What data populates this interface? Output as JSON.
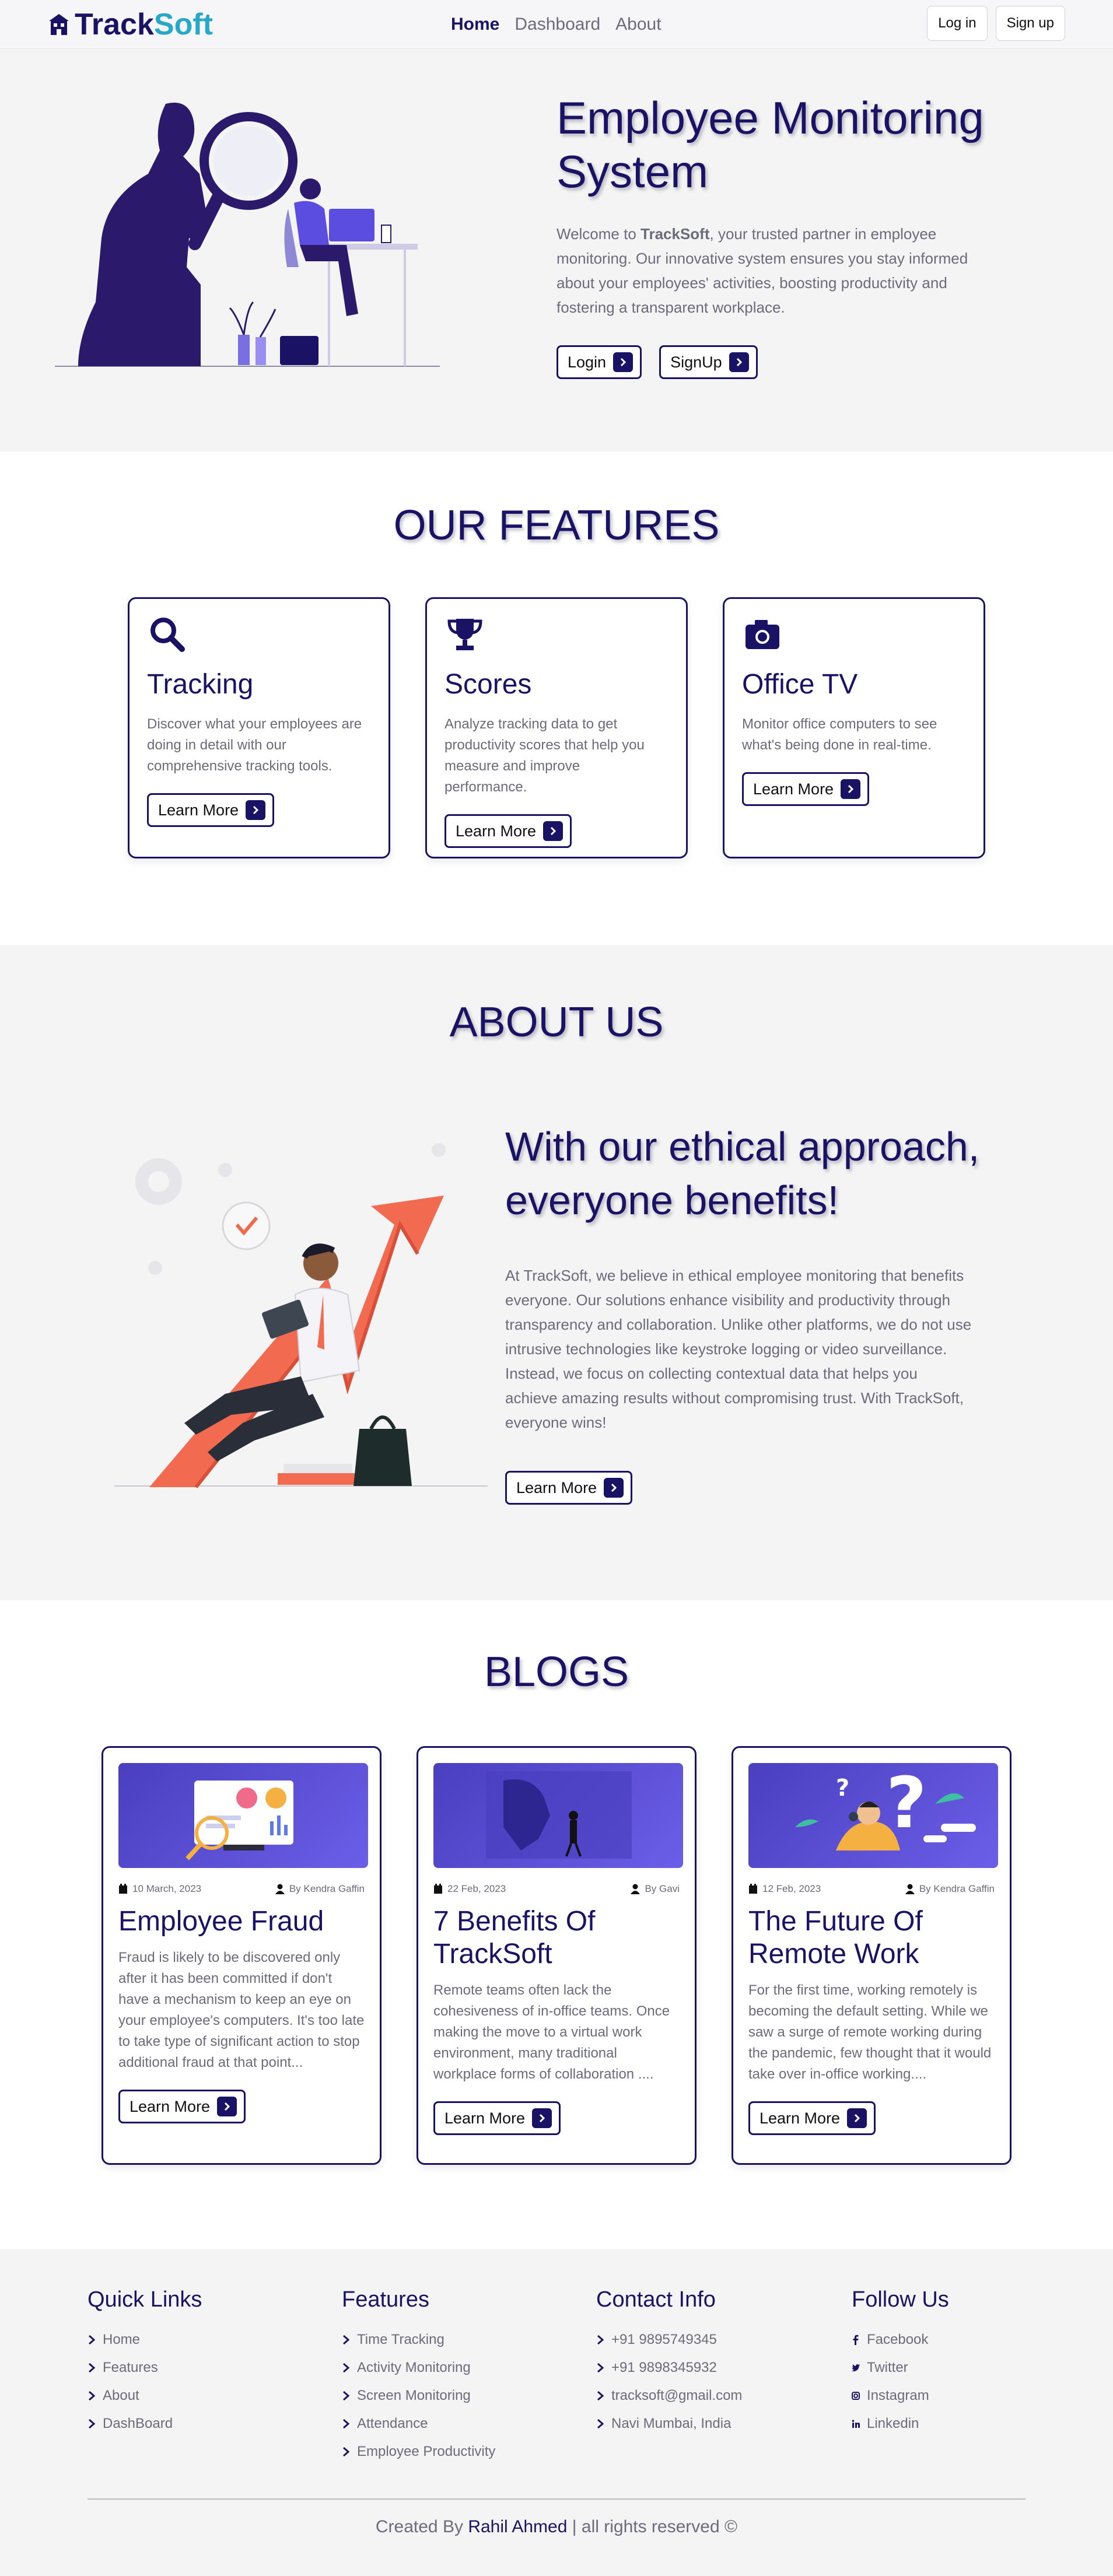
{
  "nav": {
    "brand_track": "Track",
    "brand_soft": "Soft",
    "links": [
      "Home",
      "Dashboard",
      "About"
    ],
    "login": "Log in",
    "signup": "Sign up"
  },
  "hero": {
    "title": "Employee Monitoring System",
    "desc_prefix": "Welcome to ",
    "desc_brand": "TrackSoft",
    "desc_rest": ", your trusted partner in employee monitoring. Our innovative system ensures you stay informed about your employees' activities, boosting productivity and fostering a transparent workplace.",
    "login_btn": "Login",
    "signup_btn": "SignUp"
  },
  "features": {
    "title": "OUR FEATURES",
    "cards": [
      {
        "icon": "search-icon",
        "title": "Tracking",
        "desc": "Discover what your employees are doing in detail with our comprehensive tracking tools.",
        "button": "Learn More"
      },
      {
        "icon": "trophy-icon",
        "title": "Scores",
        "desc": "Analyze tracking data to get productivity scores that help you measure and improve performance.",
        "button": "Learn More"
      },
      {
        "icon": "camera-icon",
        "title": "Office TV",
        "desc": "Monitor office computers to see what's being done in real-time.",
        "button": "Learn More"
      }
    ]
  },
  "about": {
    "title": "ABOUT US",
    "heading": "With our ethical approach, everyone benefits!",
    "desc": "At TrackSoft, we believe in ethical employee monitoring that benefits everyone. Our solutions enhance visibility and productivity through transparency and collaboration. Unlike other platforms, we do not use intrusive technologies like keystroke logging or video surveillance. Instead, we focus on collecting contextual data that helps you achieve amazing results without compromising trust. With TrackSoft, everyone wins!",
    "button": "Learn More"
  },
  "blogs": {
    "title": "BLOGS",
    "posts": [
      {
        "date": "10 March, 2023",
        "author": "By Kendra Gaffin",
        "title": "Employee Fraud",
        "excerpt": "Fraud is likely to be discovered only after it has been committed if don't have a mechanism to keep an eye on your employee's computers. It's too late to take type of significant action to stop additional fraud at that point...",
        "button": "Learn More"
      },
      {
        "date": "22 Feb, 2023",
        "author": "By Gavi",
        "title": "7 Benefits Of TrackSoft",
        "excerpt": "Remote teams often lack the cohesiveness of in-office teams. Once making the move to a virtual work environment, many traditional workplace forms of collaboration ....",
        "button": "Learn More"
      },
      {
        "date": "12 Feb, 2023",
        "author": "By Kendra Gaffin",
        "title": "The Future Of Remote Work",
        "excerpt": "For the first time, working remotely is becoming the default setting. While we saw a surge of remote working during the pandemic, few thought that it would take over in-office working....",
        "button": "Learn More"
      }
    ]
  },
  "footer": {
    "quick_links": {
      "title": "Quick Links",
      "items": [
        "Home",
        "Features",
        "About",
        "DashBoard"
      ]
    },
    "features": {
      "title": "Features",
      "items": [
        "Time Tracking",
        "Activity Monitoring",
        "Screen Monitoring",
        "Attendance",
        "Employee Productivity"
      ]
    },
    "contact": {
      "title": "Contact Info",
      "items": [
        "+91 9895749345",
        "+91 9898345932",
        "tracksoft@gmail.com",
        "Navi Mumbai, India"
      ]
    },
    "follow": {
      "title": "Follow Us",
      "items": [
        "Facebook",
        "Twitter",
        "Instagram",
        "Linkedin"
      ]
    },
    "copyright_prefix": "Created By ",
    "copyright_name": "Rahil Ahmed",
    "copyright_suffix": " | all rights reserved ©"
  }
}
